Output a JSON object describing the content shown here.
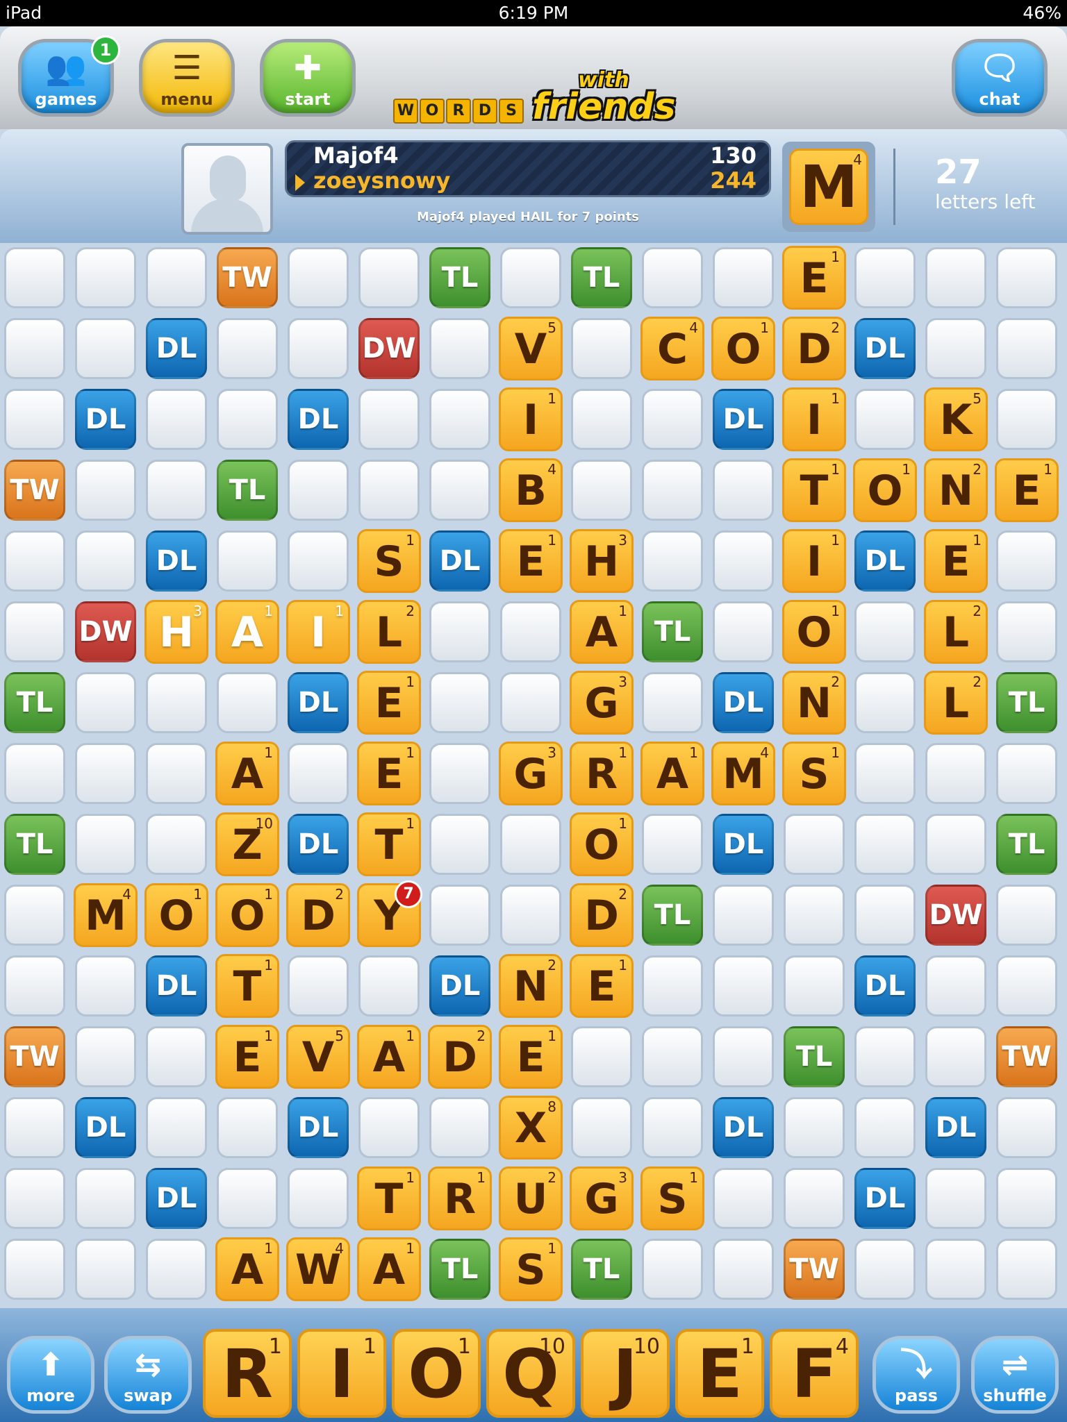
{
  "status_bar": {
    "device": "iPad",
    "time": "6:19 PM",
    "battery": "46%"
  },
  "top_bar": {
    "games": {
      "label": "games",
      "badge": "1",
      "icon": "people-icon"
    },
    "menu": {
      "label": "menu",
      "icon": "hamburger-icon"
    },
    "start": {
      "label": "start",
      "icon": "plus-icon"
    },
    "logo": {
      "words": [
        "W",
        "O",
        "R",
        "D",
        "S"
      ],
      "with": "with",
      "friends": "friends"
    },
    "chat": {
      "label": "chat",
      "icon": "speech-bubble-icon"
    }
  },
  "score_bar": {
    "player1": {
      "name": "Majof4",
      "score": "130"
    },
    "player2": {
      "name": "zoeysnowy",
      "score": "244"
    },
    "last_play": "Majof4 played  HAIL for 7 points",
    "my_letter": {
      "letter": "M",
      "points": "4"
    },
    "letters_left": {
      "count": "27",
      "label": "letters left"
    }
  },
  "board": {
    "size": 15,
    "last_play_points": "7",
    "bonus_squares": [
      {
        "row": 0,
        "col": 3,
        "type": "TW"
      },
      {
        "row": 0,
        "col": 6,
        "type": "TL"
      },
      {
        "row": 0,
        "col": 8,
        "type": "TL"
      },
      {
        "row": 1,
        "col": 2,
        "type": "DL"
      },
      {
        "row": 1,
        "col": 5,
        "type": "DW"
      },
      {
        "row": 1,
        "col": 12,
        "type": "DL"
      },
      {
        "row": 2,
        "col": 1,
        "type": "DL"
      },
      {
        "row": 2,
        "col": 4,
        "type": "DL"
      },
      {
        "row": 2,
        "col": 10,
        "type": "DL"
      },
      {
        "row": 3,
        "col": 0,
        "type": "TW"
      },
      {
        "row": 3,
        "col": 3,
        "type": "TL"
      },
      {
        "row": 4,
        "col": 2,
        "type": "DL"
      },
      {
        "row": 4,
        "col": 6,
        "type": "DL"
      },
      {
        "row": 4,
        "col": 12,
        "type": "DL"
      },
      {
        "row": 5,
        "col": 1,
        "type": "DW"
      },
      {
        "row": 5,
        "col": 9,
        "type": "TL"
      },
      {
        "row": 6,
        "col": 0,
        "type": "TL"
      },
      {
        "row": 6,
        "col": 4,
        "type": "DL"
      },
      {
        "row": 6,
        "col": 10,
        "type": "DL"
      },
      {
        "row": 6,
        "col": 14,
        "type": "TL"
      },
      {
        "row": 8,
        "col": 0,
        "type": "TL"
      },
      {
        "row": 8,
        "col": 4,
        "type": "DL"
      },
      {
        "row": 8,
        "col": 10,
        "type": "DL"
      },
      {
        "row": 8,
        "col": 14,
        "type": "TL"
      },
      {
        "row": 9,
        "col": 9,
        "type": "TL"
      },
      {
        "row": 9,
        "col": 13,
        "type": "DW"
      },
      {
        "row": 10,
        "col": 2,
        "type": "DL"
      },
      {
        "row": 10,
        "col": 6,
        "type": "DL"
      },
      {
        "row": 10,
        "col": 12,
        "type": "DL"
      },
      {
        "row": 11,
        "col": 0,
        "type": "TW"
      },
      {
        "row": 11,
        "col": 11,
        "type": "TL"
      },
      {
        "row": 11,
        "col": 14,
        "type": "TW"
      },
      {
        "row": 12,
        "col": 1,
        "type": "DL"
      },
      {
        "row": 12,
        "col": 4,
        "type": "DL"
      },
      {
        "row": 12,
        "col": 10,
        "type": "DL"
      },
      {
        "row": 12,
        "col": 13,
        "type": "DL"
      },
      {
        "row": 13,
        "col": 2,
        "type": "DL"
      },
      {
        "row": 13,
        "col": 12,
        "type": "DL"
      },
      {
        "row": 14,
        "col": 6,
        "type": "TL"
      },
      {
        "row": 14,
        "col": 8,
        "type": "TL"
      },
      {
        "row": 14,
        "col": 11,
        "type": "TW"
      }
    ],
    "tiles": [
      {
        "row": 0,
        "col": 11,
        "letter": "E",
        "points": "1"
      },
      {
        "row": 1,
        "col": 7,
        "letter": "V",
        "points": "5"
      },
      {
        "row": 1,
        "col": 9,
        "letter": "C",
        "points": "4"
      },
      {
        "row": 1,
        "col": 10,
        "letter": "O",
        "points": "1"
      },
      {
        "row": 1,
        "col": 11,
        "letter": "D",
        "points": "2"
      },
      {
        "row": 2,
        "col": 7,
        "letter": "I",
        "points": "1"
      },
      {
        "row": 2,
        "col": 11,
        "letter": "I",
        "points": "1"
      },
      {
        "row": 2,
        "col": 13,
        "letter": "K",
        "points": "5"
      },
      {
        "row": 3,
        "col": 7,
        "letter": "B",
        "points": "4"
      },
      {
        "row": 3,
        "col": 11,
        "letter": "T",
        "points": "1"
      },
      {
        "row": 3,
        "col": 12,
        "letter": "O",
        "points": "1"
      },
      {
        "row": 3,
        "col": 13,
        "letter": "N",
        "points": "2"
      },
      {
        "row": 3,
        "col": 14,
        "letter": "E",
        "points": "1"
      },
      {
        "row": 4,
        "col": 5,
        "letter": "S",
        "points": "1"
      },
      {
        "row": 4,
        "col": 7,
        "letter": "E",
        "points": "1"
      },
      {
        "row": 4,
        "col": 8,
        "letter": "H",
        "points": "3"
      },
      {
        "row": 4,
        "col": 11,
        "letter": "I",
        "points": "1"
      },
      {
        "row": 4,
        "col": 13,
        "letter": "E",
        "points": "1"
      },
      {
        "row": 5,
        "col": 2,
        "letter": "H",
        "points": "3",
        "new": true
      },
      {
        "row": 5,
        "col": 3,
        "letter": "A",
        "points": "1",
        "new": true
      },
      {
        "row": 5,
        "col": 4,
        "letter": "I",
        "points": "1",
        "new": true
      },
      {
        "row": 5,
        "col": 5,
        "letter": "L",
        "points": "2"
      },
      {
        "row": 5,
        "col": 8,
        "letter": "A",
        "points": "1"
      },
      {
        "row": 5,
        "col": 11,
        "letter": "O",
        "points": "1"
      },
      {
        "row": 5,
        "col": 13,
        "letter": "L",
        "points": "2"
      },
      {
        "row": 6,
        "col": 5,
        "letter": "E",
        "points": "1"
      },
      {
        "row": 6,
        "col": 8,
        "letter": "G",
        "points": "3"
      },
      {
        "row": 6,
        "col": 11,
        "letter": "N",
        "points": "2"
      },
      {
        "row": 6,
        "col": 13,
        "letter": "L",
        "points": "2"
      },
      {
        "row": 7,
        "col": 3,
        "letter": "A",
        "points": "1"
      },
      {
        "row": 7,
        "col": 5,
        "letter": "E",
        "points": "1"
      },
      {
        "row": 7,
        "col": 7,
        "letter": "G",
        "points": "3"
      },
      {
        "row": 7,
        "col": 8,
        "letter": "R",
        "points": "1"
      },
      {
        "row": 7,
        "col": 9,
        "letter": "A",
        "points": "1"
      },
      {
        "row": 7,
        "col": 10,
        "letter": "M",
        "points": "4"
      },
      {
        "row": 7,
        "col": 11,
        "letter": "S",
        "points": "1"
      },
      {
        "row": 8,
        "col": 3,
        "letter": "Z",
        "points": "10"
      },
      {
        "row": 8,
        "col": 5,
        "letter": "T",
        "points": "1"
      },
      {
        "row": 8,
        "col": 8,
        "letter": "O",
        "points": "1"
      },
      {
        "row": 9,
        "col": 1,
        "letter": "M",
        "points": "4"
      },
      {
        "row": 9,
        "col": 2,
        "letter": "O",
        "points": "1"
      },
      {
        "row": 9,
        "col": 3,
        "letter": "O",
        "points": "1"
      },
      {
        "row": 9,
        "col": 4,
        "letter": "D",
        "points": "2"
      },
      {
        "row": 9,
        "col": 5,
        "letter": "Y",
        "points": "3"
      },
      {
        "row": 9,
        "col": 8,
        "letter": "D",
        "points": "2"
      },
      {
        "row": 10,
        "col": 3,
        "letter": "T",
        "points": "1"
      },
      {
        "row": 10,
        "col": 7,
        "letter": "N",
        "points": "2"
      },
      {
        "row": 10,
        "col": 8,
        "letter": "E",
        "points": "1"
      },
      {
        "row": 11,
        "col": 3,
        "letter": "E",
        "points": "1"
      },
      {
        "row": 11,
        "col": 4,
        "letter": "V",
        "points": "5"
      },
      {
        "row": 11,
        "col": 5,
        "letter": "A",
        "points": "1"
      },
      {
        "row": 11,
        "col": 6,
        "letter": "D",
        "points": "2"
      },
      {
        "row": 11,
        "col": 7,
        "letter": "E",
        "points": "1"
      },
      {
        "row": 12,
        "col": 7,
        "letter": "X",
        "points": "8"
      },
      {
        "row": 13,
        "col": 5,
        "letter": "T",
        "points": "1"
      },
      {
        "row": 13,
        "col": 6,
        "letter": "R",
        "points": "1"
      },
      {
        "row": 13,
        "col": 7,
        "letter": "U",
        "points": "2"
      },
      {
        "row": 13,
        "col": 8,
        "letter": "G",
        "points": "3"
      },
      {
        "row": 13,
        "col": 9,
        "letter": "S",
        "points": "1"
      },
      {
        "row": 14,
        "col": 3,
        "letter": "A",
        "points": "1"
      },
      {
        "row": 14,
        "col": 4,
        "letter": "W",
        "points": "4"
      },
      {
        "row": 14,
        "col": 5,
        "letter": "A",
        "points": "1"
      },
      {
        "row": 14,
        "col": 7,
        "letter": "S",
        "points": "1"
      }
    ]
  },
  "bottom_bar": {
    "more": {
      "label": "more",
      "icon": "up-arrow-icon"
    },
    "swap": {
      "label": "swap",
      "icon": "swap-tiles-icon"
    },
    "rack": [
      {
        "letter": "R",
        "points": "1"
      },
      {
        "letter": "I",
        "points": "1"
      },
      {
        "letter": "O",
        "points": "1"
      },
      {
        "letter": "Q",
        "points": "10"
      },
      {
        "letter": "J",
        "points": "10"
      },
      {
        "letter": "E",
        "points": "1"
      },
      {
        "letter": "F",
        "points": "4"
      }
    ],
    "pass": {
      "label": "pass",
      "icon": "curved-arrow-icon"
    },
    "shuffle": {
      "label": "shuffle",
      "icon": "shuffle-icon"
    }
  }
}
